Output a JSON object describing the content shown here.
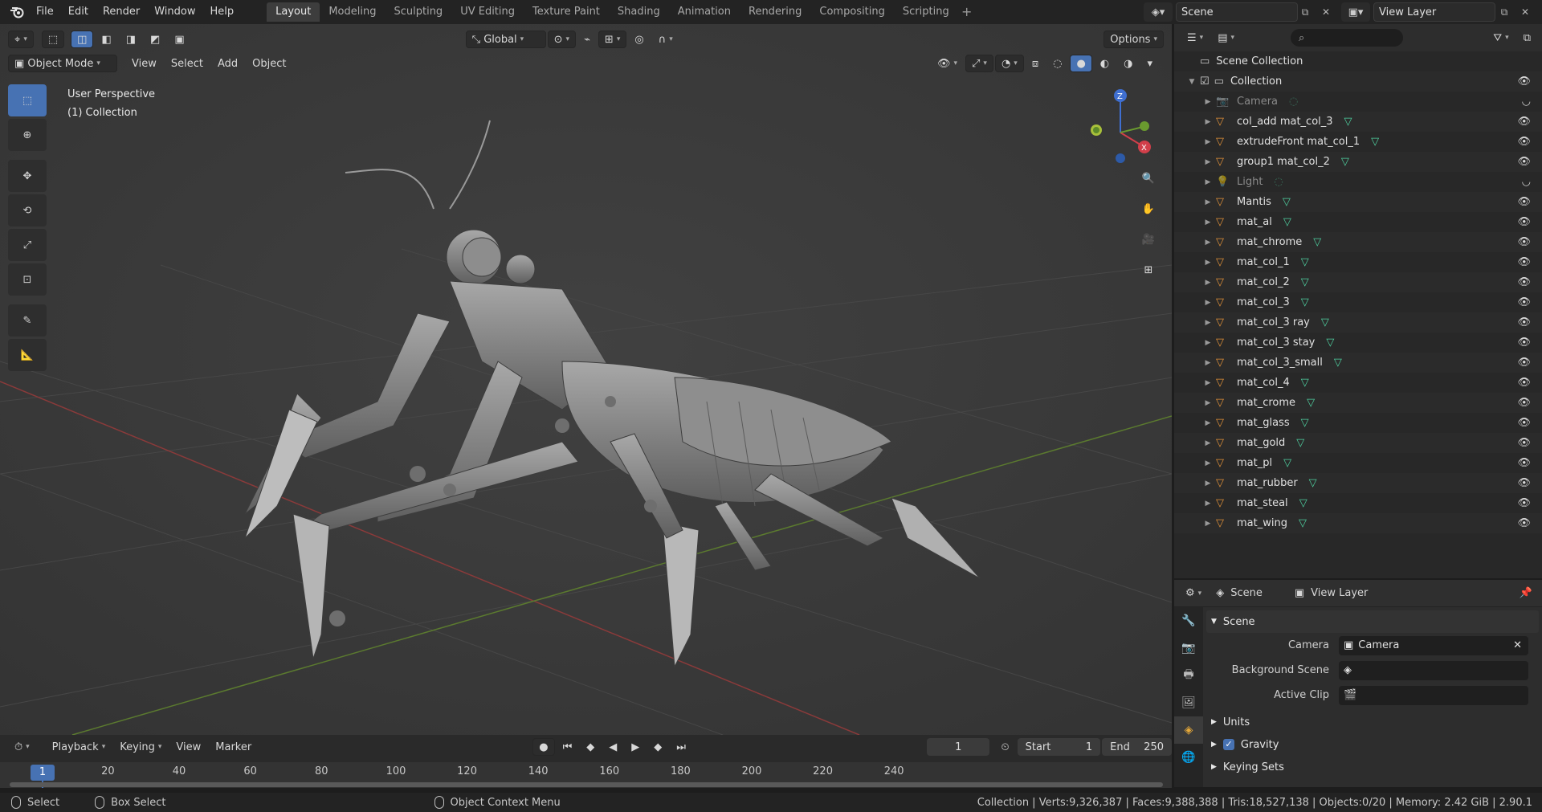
{
  "topbar": {
    "menus": [
      "File",
      "Edit",
      "Render",
      "Window",
      "Help"
    ],
    "workspaces": [
      "Layout",
      "Modeling",
      "Sculpting",
      "UV Editing",
      "Texture Paint",
      "Shading",
      "Animation",
      "Rendering",
      "Compositing",
      "Scripting"
    ],
    "active_workspace": "Layout",
    "scene": "Scene",
    "view_layer": "View Layer"
  },
  "viewport": {
    "orientation": "Global",
    "options": "Options",
    "mode": "Object Mode",
    "menus": [
      "View",
      "Select",
      "Add",
      "Object"
    ],
    "info_line1": "User Perspective",
    "info_line2": "(1) Collection",
    "gizmo": {
      "z": "Z",
      "x": "X"
    }
  },
  "outliner": {
    "root": "Scene Collection",
    "collection": "Collection",
    "items": [
      {
        "name": "Camera",
        "icon": "camera-icon",
        "dim": true
      },
      {
        "name": "col_add mat_col_3",
        "icon": "mesh-object-icon",
        "dim": false
      },
      {
        "name": "extrudeFront mat_col_1",
        "icon": "mesh-object-icon",
        "dim": false
      },
      {
        "name": "group1 mat_col_2",
        "icon": "mesh-object-icon",
        "dim": false
      },
      {
        "name": "Light",
        "icon": "light-icon",
        "dim": true
      },
      {
        "name": "Mantis",
        "icon": "mesh-object-icon",
        "dim": false
      },
      {
        "name": "mat_al",
        "icon": "mesh-object-icon",
        "dim": false
      },
      {
        "name": "mat_chrome",
        "icon": "mesh-object-icon",
        "dim": false
      },
      {
        "name": "mat_col_1",
        "icon": "mesh-object-icon",
        "dim": false
      },
      {
        "name": "mat_col_2",
        "icon": "mesh-object-icon",
        "dim": false
      },
      {
        "name": "mat_col_3",
        "icon": "mesh-object-icon",
        "dim": false
      },
      {
        "name": "mat_col_3 ray",
        "icon": "mesh-object-icon",
        "dim": false
      },
      {
        "name": "mat_col_3 stay",
        "icon": "mesh-object-icon",
        "dim": false
      },
      {
        "name": "mat_col_3_small",
        "icon": "mesh-object-icon",
        "dim": false
      },
      {
        "name": "mat_col_4",
        "icon": "mesh-object-icon",
        "dim": false
      },
      {
        "name": "mat_crome",
        "icon": "mesh-object-icon",
        "dim": false
      },
      {
        "name": "mat_glass",
        "icon": "mesh-object-icon",
        "dim": false
      },
      {
        "name": "mat_gold",
        "icon": "mesh-object-icon",
        "dim": false
      },
      {
        "name": "mat_pl",
        "icon": "mesh-object-icon",
        "dim": false
      },
      {
        "name": "mat_rubber",
        "icon": "mesh-object-icon",
        "dim": false
      },
      {
        "name": "mat_steal",
        "icon": "mesh-object-icon",
        "dim": false
      },
      {
        "name": "mat_wing",
        "icon": "mesh-object-icon",
        "dim": false
      }
    ]
  },
  "properties": {
    "breadcrumb_scene": "Scene",
    "breadcrumb_layer": "View Layer",
    "panel_title": "Scene",
    "camera_label": "Camera",
    "camera_value": "Camera",
    "background_label": "Background Scene",
    "clip_label": "Active Clip",
    "units": "Units",
    "gravity": "Gravity",
    "keying_sets": "Keying Sets"
  },
  "timeline": {
    "menus": [
      "Playback",
      "Keying",
      "View",
      "Marker"
    ],
    "current_frame": "1",
    "start_label": "Start",
    "start": "1",
    "end_label": "End",
    "end": "250",
    "ticks": [
      "20",
      "40",
      "60",
      "80",
      "100",
      "120",
      "140",
      "160",
      "180",
      "200",
      "220",
      "240"
    ]
  },
  "statusbar": {
    "select": "Select",
    "box_select": "Box Select",
    "context_menu": "Object Context Menu",
    "stats": "Collection | Verts:9,326,387 | Faces:9,388,388 | Tris:18,527,138 | Objects:0/20 | Memory: 2.42 GiB | 2.90.1"
  }
}
